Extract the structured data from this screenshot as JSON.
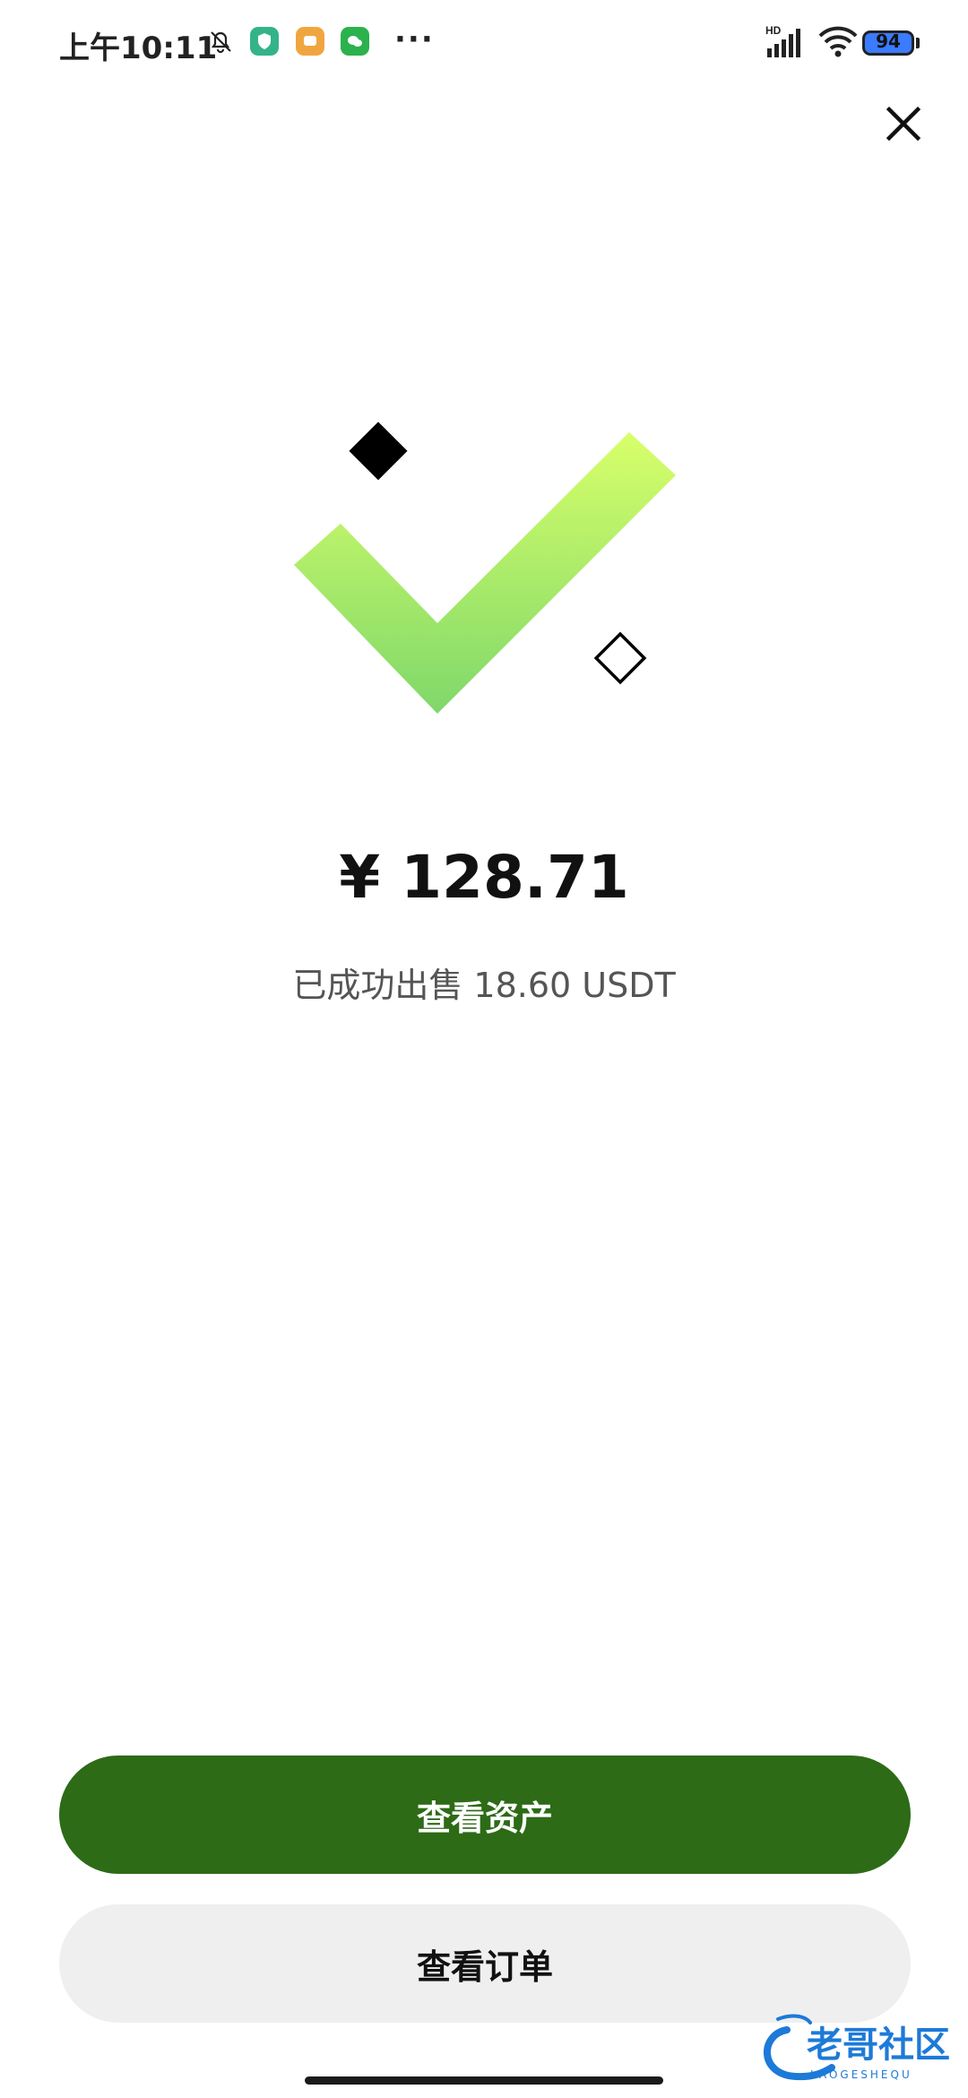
{
  "status_bar": {
    "time": "上午10:11",
    "more": "···",
    "battery": "94",
    "network": "HD",
    "icons": [
      "bell-muted-icon",
      "shield-app-icon",
      "chat-app-icon",
      "wechat-icon",
      "signal-icon",
      "wifi-icon",
      "battery-icon"
    ]
  },
  "result": {
    "amount": "¥ 128.71",
    "message": "已成功出售 18.60 USDT"
  },
  "actions": {
    "view_assets": "查看资产",
    "view_orders": "查看订单"
  },
  "watermark": {
    "text": "老哥社区",
    "sub": "LAOGESHEQU"
  },
  "colors": {
    "primary": "#2d6b17",
    "secondary_bg": "#efefef",
    "check_top": "#d8ff6a",
    "check_bottom": "#7fd86a"
  }
}
